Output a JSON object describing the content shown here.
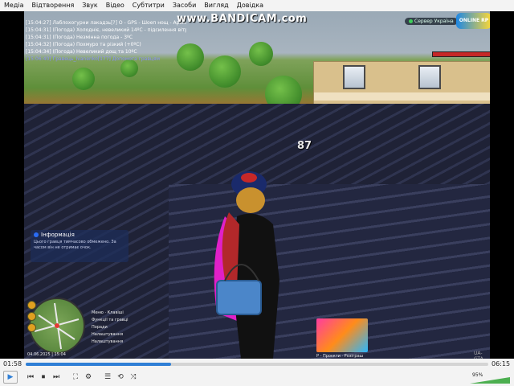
{
  "menu": [
    "Медіа",
    "Відтворення",
    "Звук",
    "Відео",
    "Субтитри",
    "Засоби",
    "Вигляд",
    "Довідка"
  ],
  "game": {
    "watermark_top": "www.BANDICAM.com",
    "chat_lines": [
      {
        "text": "[15:04:27] Лаблохогурни лакадзь[?] О - GPS - Шоеп нощ - Арена",
        "style": "t"
      },
      {
        "text": "[15:04:31] (Погода) Холодніє, невеликий 14ºС - підсилення вітру",
        "style": "t"
      },
      {
        "text": "[15:04:31] (Погода) Незмінна погода - 3ºC",
        "style": "t"
      },
      {
        "text": "[15:04:32] (Погода) Похмуро та різкий (+0ºС)",
        "style": "t"
      },
      {
        "text": "[15:04:34] (Погода) Невеликий дощ та 10ºC",
        "style": "t"
      },
      {
        "text": "[15:06:40] Гравець_Ivanenko[177] Допомога гравцям",
        "style": "h"
      }
    ],
    "server_label": "Сервер Україна",
    "logo_text": "ONLINE RP",
    "distance_marker": "87",
    "info": {
      "title": "Інформація",
      "body": "Цього гравця тимчасово обмежено. За часом він не отримає очок."
    },
    "hud_menu": [
      "Меню · Клавіші",
      "Функції та гравці",
      "Поради",
      "Налаштування",
      "Налаштування"
    ],
    "datetime": "04.06.2025 | 15:04",
    "promo_label": "Р - Проєкти · Розіграш",
    "watermark_bottom": "UA-GTA 5.0"
  },
  "player": {
    "elapsed": "01:58",
    "total": "06:15",
    "progress_fraction": 0.315,
    "volume": "95%",
    "accent": "#2f7fd6"
  },
  "controls": {
    "play_icon": "▶",
    "prev_icon": "⏮",
    "stop_icon": "⏹",
    "next_icon": "⏭",
    "fullscreen_icon": "⛶",
    "settings_icon": "⚙",
    "playlist_icon": "☰",
    "loop_icon": "⟲",
    "shuffle_icon": "⤨"
  }
}
